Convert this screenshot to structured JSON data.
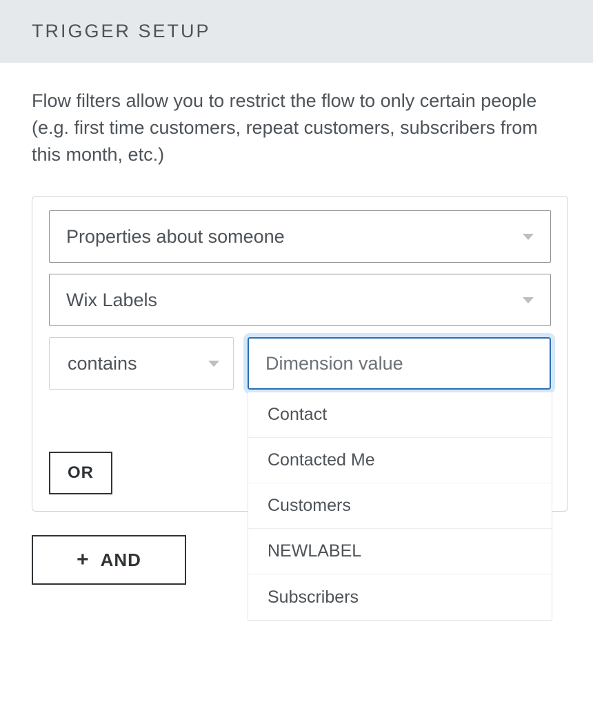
{
  "header": {
    "title": "TRIGGER SETUP"
  },
  "description": "Flow filters allow you to restrict the flow to only certain people (e.g. first time customers, repeat customers, subscribers from this month, etc.)",
  "filter": {
    "property_select": "Properties about someone",
    "field_select": "Wix Labels",
    "operator_select": "contains",
    "value_placeholder": "Dimension value",
    "value_options": [
      "Contact",
      "Contacted Me",
      "Customers",
      "NEWLABEL",
      "Subscribers"
    ],
    "or_label": "OR"
  },
  "and_button": {
    "plus": "+",
    "label": "AND"
  }
}
